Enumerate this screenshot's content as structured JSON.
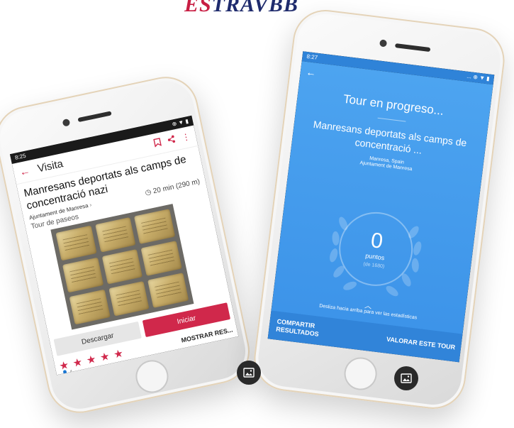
{
  "logo": {
    "accent": "ES",
    "rest": "TRAVBB"
  },
  "left": {
    "status_time": "8:25",
    "status_icons": "⊕ ▼ ▮",
    "appbar_title": "Visita",
    "tour_title": "Manresans deportats als camps de concentració nazi",
    "organizer": "Ajuntament de Manresa",
    "duration": "20 min (290 m)",
    "tour_type": "Tour de paseos",
    "download_label": "Descargar",
    "start_label": "Iniciar",
    "stars": "★ ★ ★ ★ ★",
    "show_results_label": "MOSTRAR RES...",
    "rating_count": "4"
  },
  "right": {
    "status_time": "8:27",
    "status_icons": "... ⊕ ▼ ▮",
    "heading": "Tour en progreso...",
    "tour_title": "Manresans deportats als camps de concentració ...",
    "place": "Manresa, Spain",
    "organizer": "Ajuntament de Manresa",
    "score": "0",
    "score_label": "puntos",
    "score_sub": "(de 1680)",
    "swipe_hint": "Desliza hacia arriba para ver las estadísticas",
    "share_label_1": "COMPARTIR",
    "share_label_2": "RESULTADOS",
    "rate_label": "VALORAR ESTE TOUR"
  },
  "colors": {
    "accent_red": "#d0284b",
    "blue": "#3b92e8",
    "logo_navy": "#1f2b6d"
  },
  "icons": {
    "back": "back-arrow-icon",
    "bookmark": "bookmark-icon",
    "share": "share-icon",
    "more": "more-vert-icon",
    "clock": "clock-icon",
    "person": "person-icon",
    "gallery": "image-gallery-icon",
    "wreath": "laurel-wreath-icon"
  }
}
